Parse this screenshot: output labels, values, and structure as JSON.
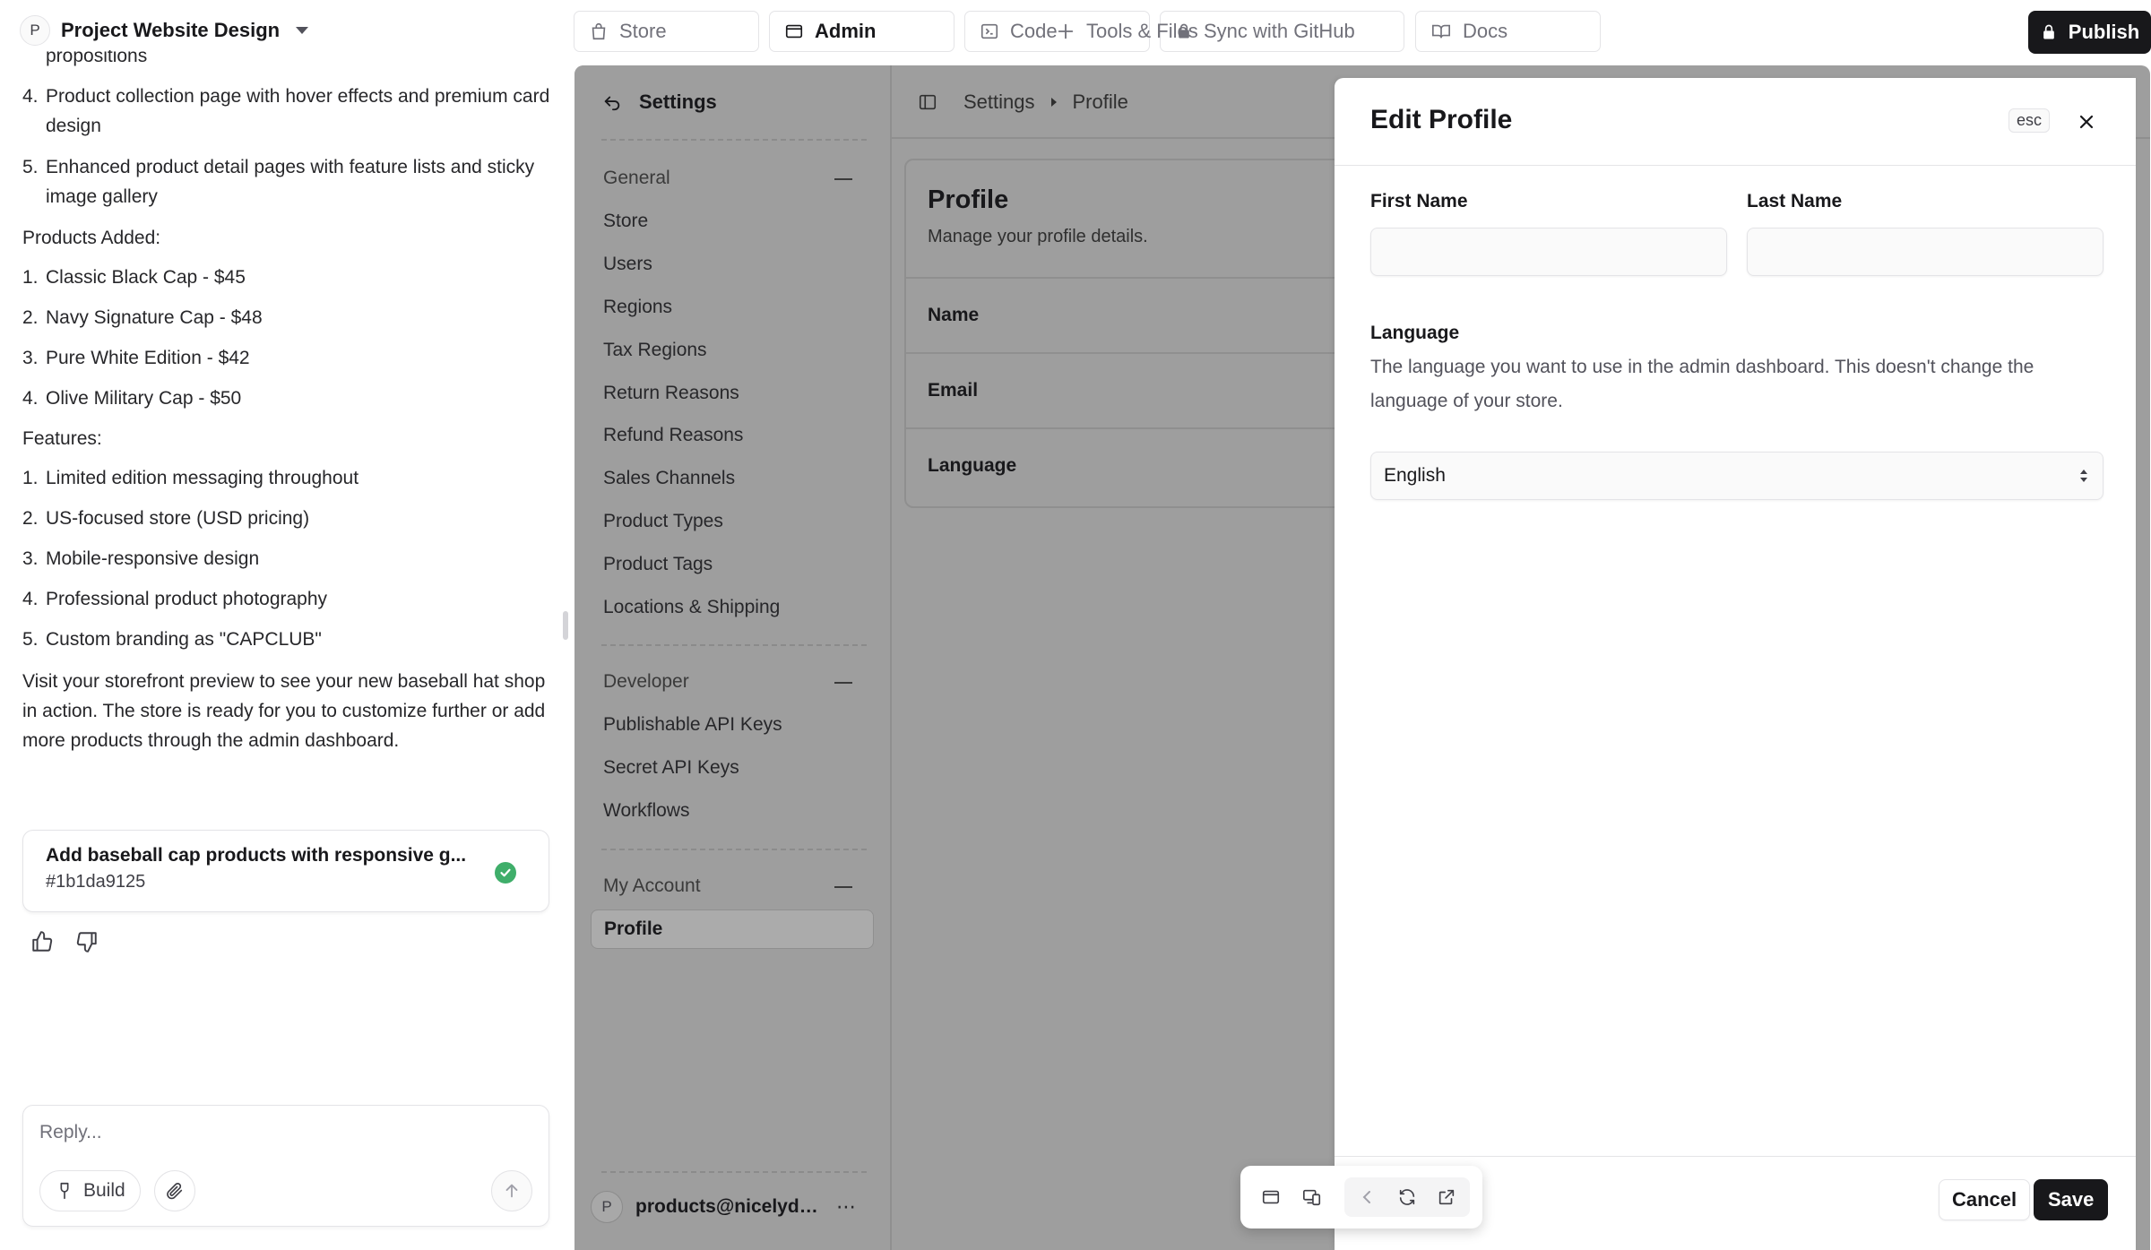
{
  "project": {
    "avatar_letter": "P",
    "name": "Project Website Design"
  },
  "chat": {
    "clipped_line": "propositions",
    "top_list": [
      {
        "num": "4.",
        "text": "Product collection page with hover effects and premium card design"
      },
      {
        "num": "5.",
        "text": "Enhanced product detail pages with feature lists and sticky image gallery"
      }
    ],
    "products_heading": "Products Added:",
    "products": [
      {
        "num": "1.",
        "text": "Classic Black Cap - $45"
      },
      {
        "num": "2.",
        "text": "Navy Signature Cap - $48"
      },
      {
        "num": "3.",
        "text": "Pure White Edition - $42"
      },
      {
        "num": "4.",
        "text": "Olive Military Cap - $50"
      }
    ],
    "features_heading": "Features:",
    "features": [
      {
        "num": "1.",
        "text": "Limited edition messaging throughout"
      },
      {
        "num": "2.",
        "text": "US-focused store (USD pricing)"
      },
      {
        "num": "3.",
        "text": "Mobile-responsive design"
      },
      {
        "num": "4.",
        "text": "Professional product photography"
      },
      {
        "num": "5.",
        "text": "Custom branding as \"CAPCLUB\""
      }
    ],
    "closing_paragraph": "Visit your storefront preview to see your new baseball hat shop in action. The store is ready for you to customize further or add more products through the admin dashboard.",
    "commit": {
      "title": "Add baseball cap products with responsive g...",
      "hash": "#1b1da9125"
    },
    "reply": {
      "placeholder": "Reply...",
      "build_label": "Build"
    }
  },
  "toolbar": {
    "tabs": [
      {
        "id": "store",
        "label": "Store"
      },
      {
        "id": "admin",
        "label": "Admin"
      },
      {
        "id": "code",
        "label": "Code"
      },
      {
        "id": "github",
        "label": "Sync with GitHub"
      },
      {
        "id": "docs",
        "label": "Docs"
      }
    ],
    "tools_label": "Tools & Files",
    "publish_label": "Publish"
  },
  "settings": {
    "back_label": "Settings",
    "groups": [
      {
        "label": "General",
        "items": [
          "Store",
          "Users",
          "Regions",
          "Tax Regions",
          "Return Reasons",
          "Refund Reasons",
          "Sales Channels",
          "Product Types",
          "Product Tags",
          "Locations & Shipping"
        ]
      },
      {
        "label": "Developer",
        "items": [
          "Publishable API Keys",
          "Secret API Keys",
          "Workflows"
        ]
      },
      {
        "label": "My Account",
        "items": [
          "Profile"
        ]
      }
    ],
    "user": {
      "avatar_letter": "P",
      "email": "products@nicelydon..."
    }
  },
  "main": {
    "breadcrumb": [
      "Settings",
      "Profile"
    ],
    "profile_card": {
      "title": "Profile",
      "subtitle": "Manage your profile details.",
      "rows": [
        "Name",
        "Email",
        "Language"
      ]
    }
  },
  "drawer": {
    "title": "Edit Profile",
    "esc_label": "esc",
    "first_name_label": "First Name",
    "first_name_value": "",
    "last_name_label": "Last Name",
    "last_name_value": "",
    "language_label": "Language",
    "language_description": "The language you want to use in the admin dashboard. This doesn't change the language of your store.",
    "language_value": "English",
    "cancel_label": "Cancel",
    "save_label": "Save"
  },
  "colors": {
    "success": "#3fae6a",
    "primary_dark": "#18181b",
    "overlay_gray": "#9e9e9e"
  }
}
